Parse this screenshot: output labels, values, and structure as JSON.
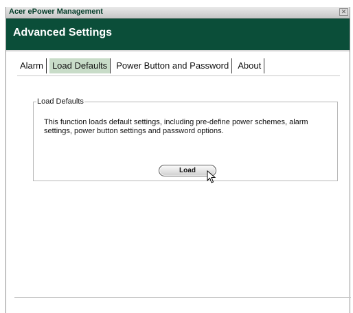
{
  "window": {
    "title": "Acer ePower Management",
    "close_symbol": "✕"
  },
  "header": {
    "title": "Advanced Settings"
  },
  "tabs": [
    {
      "label": "Alarm"
    },
    {
      "label": "Load Defaults"
    },
    {
      "label": "Power Button and Password"
    },
    {
      "label": "About"
    }
  ],
  "active_tab": "Load Defaults",
  "group": {
    "legend": "Load Defaults",
    "description": "This function loads default settings, including pre-define power schemes, alarm settings, power button settings and password options.",
    "button_label": "Load"
  },
  "colors": {
    "header_bg": "#0b4e39",
    "active_tab_bg": "#c8dcc8"
  },
  "icons": [
    "close-icon",
    "mouse-cursor-icon"
  ]
}
